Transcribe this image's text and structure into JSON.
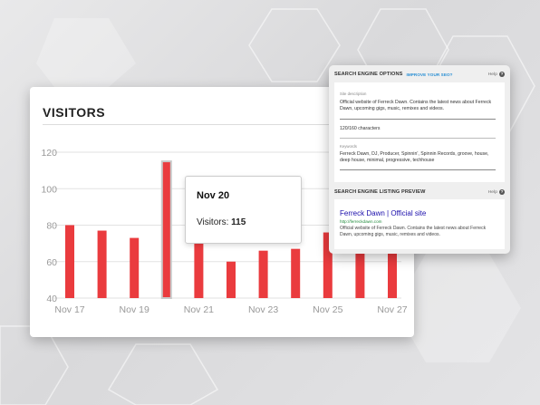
{
  "visitors": {
    "title": "VISITORS",
    "tooltip": {
      "date": "Nov 20",
      "label": "Visitors:",
      "value": "115"
    }
  },
  "chart_data": {
    "type": "bar",
    "title": "VISITORS",
    "categories": [
      "Nov 17",
      "Nov 18",
      "Nov 19",
      "Nov 20",
      "Nov 21",
      "Nov 22",
      "Nov 23",
      "Nov 24",
      "Nov 25",
      "Nov 26",
      "Nov 27"
    ],
    "x_tick_labels": [
      "Nov 17",
      "Nov 19",
      "Nov 21",
      "Nov 23",
      "Nov 25",
      "Nov 27"
    ],
    "values": [
      80,
      77,
      73,
      115,
      71,
      60,
      66,
      67,
      76,
      72,
      65
    ],
    "ylim": [
      40,
      120
    ],
    "y_ticks": [
      40,
      60,
      80,
      100,
      120
    ],
    "grid": true,
    "highlighted_category": "Nov 20",
    "bar_color": "#ea3b3e"
  },
  "seo": {
    "options_title": "SEARCH ENGINE OPTIONS",
    "options_link": "IMPROVE YOUR SEO?",
    "help": "Help",
    "description_label": "Site description",
    "description_text": "Official website of Ferreck Dawn. Contains the latest news about Ferreck Dawn, upcoming gigs, music, remixes and videos.",
    "char_count": "120/160 characters",
    "keywords_label": "Keywords",
    "keywords_text": "Ferreck Dawn, DJ, Producer, Spinnin', Spinnin Records, groove, house, deep house, minimal, progressive, techhouse",
    "preview_title": "SEARCH ENGINE LISTING PREVIEW",
    "preview_help": "Help",
    "result_title": "Ferreck Dawn | Official site",
    "result_url": "http://ferreckdawn.com",
    "result_desc": "Official website of Ferreck Dawn. Contains the latest news about Ferreck Dawn, upcoming gigs, music, remixes and videos.",
    "help_icon": "question-circle-icon"
  }
}
